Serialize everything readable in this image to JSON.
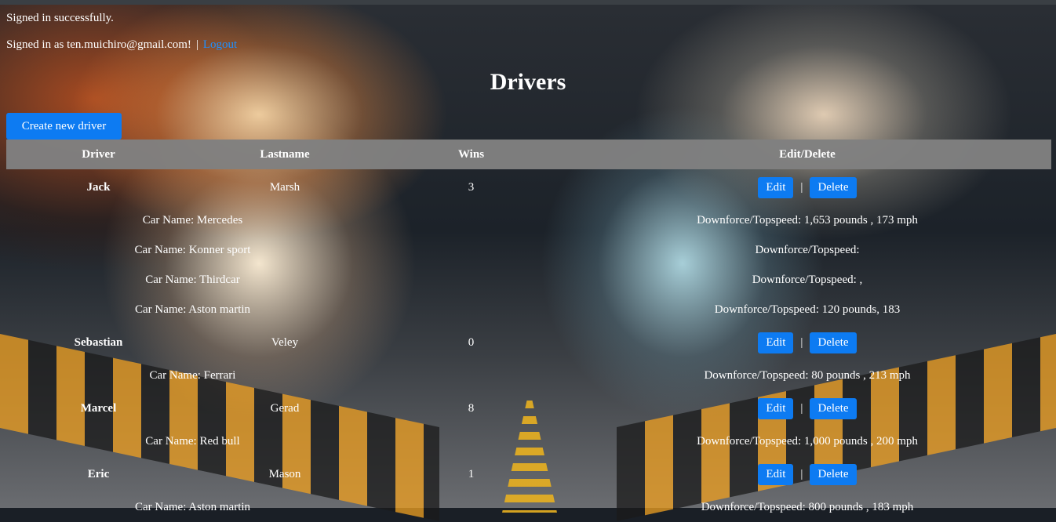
{
  "flash": "Signed in successfully.",
  "user": {
    "prefix": "Signed in as ten.muichiro@gmail.com!",
    "separator": "|",
    "logout_label": "Logout"
  },
  "page_title": "Drivers",
  "create_button_label": "Create new driver",
  "table": {
    "headers": [
      "Driver",
      "Lastname",
      "Wins",
      "Edit/Delete"
    ],
    "edit_label": "Edit",
    "delete_label": "Delete",
    "action_separator": "|",
    "drivers": [
      {
        "first": "Jack",
        "last": "Marsh",
        "wins": "3",
        "cars": [
          {
            "name": "Car Name: Mercedes",
            "spec": "Downforce/Topspeed: 1,653 pounds , 173 mph"
          },
          {
            "name": "Car Name: Konner sport",
            "spec": "Downforce/Topspeed:"
          },
          {
            "name": "Car Name: Thirdcar",
            "spec": "Downforce/Topspeed: ,"
          },
          {
            "name": "Car Name: Aston martin",
            "spec": "Downforce/Topspeed: 120 pounds, 183"
          }
        ]
      },
      {
        "first": "Sebastian",
        "last": "Veley",
        "wins": "0",
        "cars": [
          {
            "name": "Car Name: Ferrari",
            "spec": "Downforce/Topspeed: 80 pounds , 213 mph"
          }
        ]
      },
      {
        "first": "Marcel",
        "last": "Gerad",
        "wins": "8",
        "cars": [
          {
            "name": "Car Name: Red bull",
            "spec": "Downforce/Topspeed: 1,000 pounds , 200 mph"
          }
        ]
      },
      {
        "first": "Eric",
        "last": "Mason",
        "wins": "1",
        "cars": [
          {
            "name": "Car Name: Aston martin",
            "spec": "Downforce/Topspeed: 800 pounds , 183 mph"
          }
        ]
      }
    ]
  }
}
